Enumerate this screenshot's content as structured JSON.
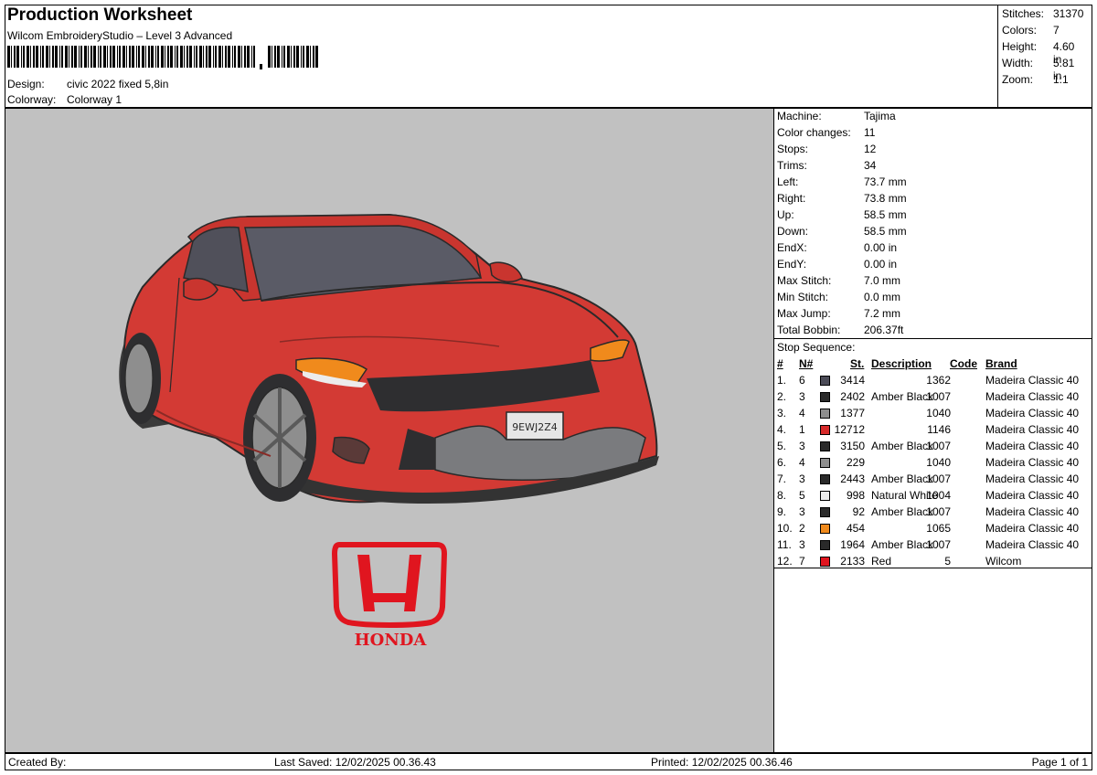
{
  "header": {
    "title": "Production Worksheet",
    "subtitle": "Wilcom EmbroideryStudio – Level 3 Advanced",
    "design_label": "Design:",
    "design_value": "civic 2022 fixed 5,8in",
    "colorway_label": "Colorway:",
    "colorway_value": "Colorway 1"
  },
  "summary": [
    {
      "label": "Stitches:",
      "value": "31370"
    },
    {
      "label": "Colors:",
      "value": "7"
    },
    {
      "label": "Height:",
      "value": "4.60 in"
    },
    {
      "label": "Width:",
      "value": "5.81 in"
    },
    {
      "label": "Zoom:",
      "value": "1:1"
    }
  ],
  "details": [
    {
      "label": "Machine:",
      "value": "Tajima"
    },
    {
      "label": "Color changes:",
      "value": "11"
    },
    {
      "label": "Stops:",
      "value": "12"
    },
    {
      "label": "Trims:",
      "value": "34"
    },
    {
      "label": "Left:",
      "value": "73.7 mm"
    },
    {
      "label": "Right:",
      "value": "73.8 mm"
    },
    {
      "label": "Up:",
      "value": "58.5 mm"
    },
    {
      "label": "Down:",
      "value": "58.5 mm"
    },
    {
      "label": "EndX:",
      "value": "0.00 in"
    },
    {
      "label": "EndY:",
      "value": "0.00 in"
    },
    {
      "label": "Max Stitch:",
      "value": "7.0 mm"
    },
    {
      "label": "Min Stitch:",
      "value": "0.0 mm"
    },
    {
      "label": "Max Jump:",
      "value": "7.2 mm"
    },
    {
      "label": "Total Bobbin:",
      "value": "206.37ft"
    }
  ],
  "stop_sequence": {
    "title": "Stop Sequence:",
    "headers": {
      "num": "#",
      "n": "N#",
      "st": "St.",
      "description": "Description",
      "code": "Code",
      "brand": "Brand"
    },
    "rows": [
      {
        "num": "1.",
        "n": "6",
        "color": "#4b4b57",
        "st": "3414",
        "description": "",
        "code": "1362",
        "brand": "Madeira Classic 40"
      },
      {
        "num": "2.",
        "n": "3",
        "color": "#2a2a2a",
        "st": "2402",
        "description": "Amber Black",
        "code": "1007",
        "brand": "Madeira Classic 40"
      },
      {
        "num": "3.",
        "n": "4",
        "color": "#8e8e8e",
        "st": "1377",
        "description": "",
        "code": "1040",
        "brand": "Madeira Classic 40"
      },
      {
        "num": "4.",
        "n": "1",
        "color": "#d72a2a",
        "st": "12712",
        "description": "",
        "code": "1146",
        "brand": "Madeira Classic 40"
      },
      {
        "num": "5.",
        "n": "3",
        "color": "#2a2a2a",
        "st": "3150",
        "description": "Amber Black",
        "code": "1007",
        "brand": "Madeira Classic 40"
      },
      {
        "num": "6.",
        "n": "4",
        "color": "#8e8e8e",
        "st": "229",
        "description": "",
        "code": "1040",
        "brand": "Madeira Classic 40"
      },
      {
        "num": "7.",
        "n": "3",
        "color": "#2a2a2a",
        "st": "2443",
        "description": "Amber Black",
        "code": "1007",
        "brand": "Madeira Classic 40"
      },
      {
        "num": "8.",
        "n": "5",
        "color": "#ececec",
        "st": "998",
        "description": "Natural White",
        "code": "1004",
        "brand": "Madeira Classic 40"
      },
      {
        "num": "9.",
        "n": "3",
        "color": "#2a2a2a",
        "st": "92",
        "description": "Amber Black",
        "code": "1007",
        "brand": "Madeira Classic 40"
      },
      {
        "num": "10.",
        "n": "2",
        "color": "#f08a1c",
        "st": "454",
        "description": "",
        "code": "1065",
        "brand": "Madeira Classic 40"
      },
      {
        "num": "11.",
        "n": "3",
        "color": "#2a2a2a",
        "st": "1964",
        "description": "Amber Black",
        "code": "1007",
        "brand": "Madeira Classic 40"
      },
      {
        "num": "12.",
        "n": "7",
        "color": "#e0151f",
        "st": "2133",
        "description": "Red",
        "code": "5",
        "brand": "Wilcom"
      }
    ]
  },
  "preview": {
    "logo_text": "HONDA",
    "plate_text": "9EWJ2Z4"
  },
  "footer": {
    "created_by": "Created By:",
    "last_saved": "Last Saved: 12/02/2025 00.36.43",
    "printed": "Printed: 12/02/2025 00.36.46",
    "page": "Page 1 of 1"
  }
}
